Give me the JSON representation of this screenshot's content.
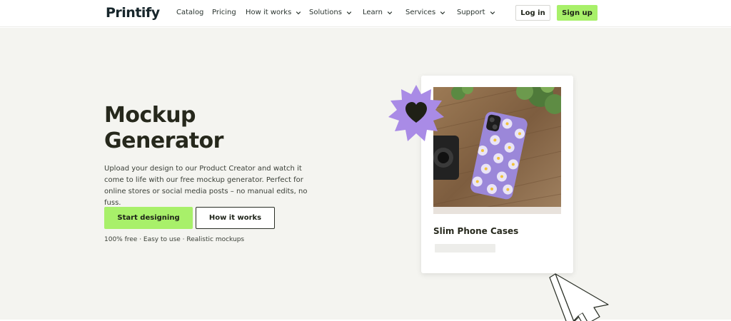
{
  "header": {
    "logo": "Printify",
    "nav": [
      {
        "label": "Catalog",
        "dropdown": false
      },
      {
        "label": "Pricing",
        "dropdown": false
      },
      {
        "label": "How it works",
        "dropdown": true
      },
      {
        "label": "Solutions",
        "dropdown": true
      },
      {
        "label": "Learn",
        "dropdown": true
      },
      {
        "label": "Services",
        "dropdown": true
      },
      {
        "label": "Support",
        "dropdown": true
      }
    ],
    "login_label": "Log in",
    "signup_label": "Sign up"
  },
  "hero": {
    "title_line1": "Mockup",
    "title_line2": "Generator",
    "description": "Upload your design to our Product Creator and watch it come to life with our free mockup generator. Perfect for online stores or social media posts – no manual edits, no fuss.",
    "primary_cta": "Start designing",
    "secondary_cta": "How it works",
    "features": "100% free · Easy to use · Realistic mockups"
  },
  "card": {
    "title": "Slim Phone Cases",
    "image_icon": "phone-case-photo",
    "badge_icon": "heart-icon",
    "cursor_icon": "cursor-arrow-icon"
  },
  "colors": {
    "accent_green": "#a8f06a",
    "hero_bg": "#f4f4f0",
    "badge_purple": "#a98be6",
    "heading_dark": "#26281c"
  }
}
